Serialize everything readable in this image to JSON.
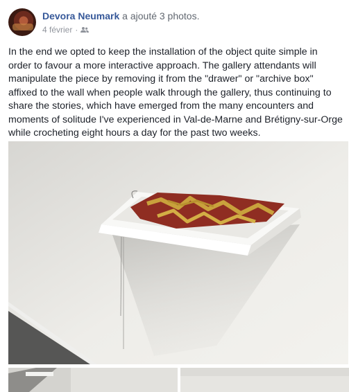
{
  "post": {
    "author": "Devora Neumark",
    "action": "a ajouté 3 photos.",
    "date": "4 février",
    "separator": "·",
    "audience_icon": "friends-icon",
    "text": "In the end we opted to keep the installation of the object quite simple in order to favour a more interactive approach. The gallery attendants will manipulate the piece by removing it from the \"drawer\" or \"archive box\" affixed to the wall when people walk through the gallery, thus continuing to share the stories, which have emerged from the many encounters and moments of solitude I've experienced in Val-de-Marne and Brétigny-sur-Orge while crocheting eight hours a day for the past two weeks."
  },
  "colors": {
    "name_link": "#365899",
    "meta_gray": "#90949c",
    "body_text": "#1d2129"
  }
}
